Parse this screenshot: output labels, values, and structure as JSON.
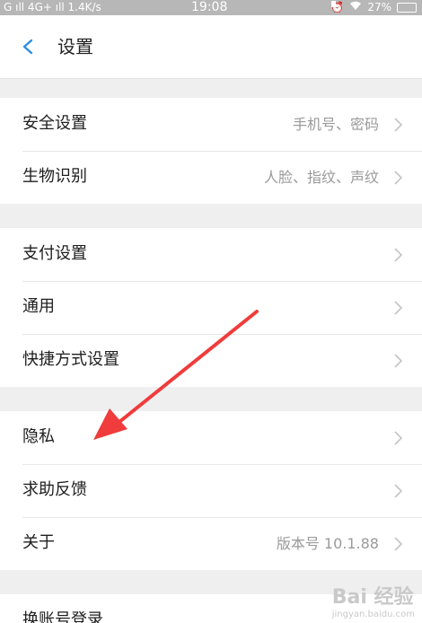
{
  "status_bar": {
    "signal": "G ıll 4G+ ıll 1.4K/s",
    "time": "19:08",
    "battery": "27%"
  },
  "header": {
    "title": "设置"
  },
  "groups": [
    {
      "items": [
        {
          "label": "安全设置",
          "value": "手机号、密码"
        },
        {
          "label": "生物识别",
          "value": "人脸、指纹、声纹"
        }
      ]
    },
    {
      "items": [
        {
          "label": "支付设置",
          "value": ""
        },
        {
          "label": "通用",
          "value": ""
        },
        {
          "label": "快捷方式设置",
          "value": ""
        }
      ]
    },
    {
      "items": [
        {
          "label": "隐私",
          "value": ""
        },
        {
          "label": "求助反馈",
          "value": ""
        },
        {
          "label": "关于",
          "value": "版本号 10.1.88"
        }
      ]
    },
    {
      "items": [
        {
          "label": "换账号登录",
          "value": ""
        }
      ]
    }
  ],
  "watermark": {
    "text": "Bai 经验",
    "subtext": "jingyan.baidu.com"
  },
  "colors": {
    "accent": "#2d8fe0",
    "annotation_arrow": "#f03c3c"
  }
}
